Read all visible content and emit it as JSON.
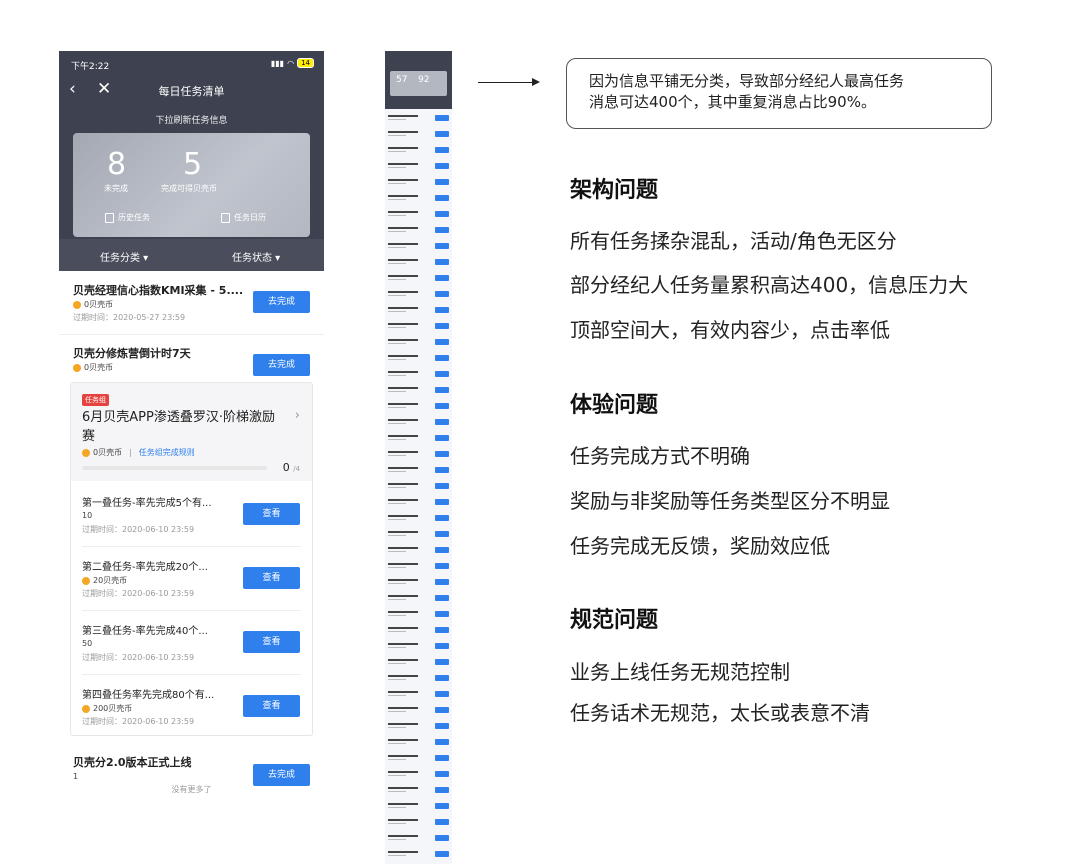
{
  "phone": {
    "status_time": "下午2:22",
    "battery": "14",
    "nav_title": "每日任务清单",
    "pull_refresh": "下拉刷新任务信息",
    "stats": {
      "unfinished_num": "8",
      "unfinished_label": "未完成",
      "coins_num": "5",
      "coins_label": "完成可得贝壳币"
    },
    "history_label": "历史任务",
    "calendar_label": "任务日历",
    "filter_category": "任务分类 ▾",
    "filter_status": "任务状态 ▾",
    "tasks": [
      {
        "title": "贝壳经理信心指数KMI采集 - 5....",
        "coin": "0贝壳币",
        "date": "过期时间：2020-05-27 23:59",
        "button": "去完成"
      },
      {
        "title": "贝壳分修炼营倒计时7天",
        "coin": "0贝壳币",
        "button": "去完成"
      }
    ],
    "group": {
      "tag": "任务组",
      "title": "6月贝壳APP渗透叠罗汉·阶梯激励赛",
      "coin": "0贝壳币",
      "sep": "|",
      "rule": "任务组完成规则",
      "progress_done": "0",
      "progress_total": "/4",
      "progress_fraction": 0,
      "subtasks": [
        {
          "title": "第一叠任务-率先完成5个有...",
          "coin": "10",
          "date": "过期时间：2020-06-10 23:59",
          "button": "查看",
          "has_coin": false
        },
        {
          "title": "第二叠任务-率先完成20个...",
          "coin": "20贝壳币",
          "date": "过期时间：2020-06-10 23:59",
          "button": "查看",
          "has_coin": true
        },
        {
          "title": "第三叠任务-率先完成40个...",
          "coin": "50",
          "date": "过期时间：2020-06-10 23:59",
          "button": "查看",
          "has_coin": false
        },
        {
          "title": "第四叠任务率先完成80个有...",
          "coin": "200贝壳币",
          "date": "过期时间：2020-06-10 23:59",
          "button": "查看",
          "has_coin": true
        }
      ]
    },
    "last_task": {
      "title": "贝壳分2.0版本正式上线",
      "coin": "1",
      "button": "去完成"
    },
    "no_more": "没有更多了"
  },
  "strip": {
    "stat_a": "57",
    "stat_b": "92"
  },
  "note": {
    "line1": "因为信息平铺无分类，导致部分经纪人最高任务",
    "line2": "消息可达400个，其中重复消息占比90%。"
  },
  "sections": [
    {
      "title": "架构问题",
      "items": [
        "所有任务揉杂混乱，活动/角色无区分",
        "部分经纪人任务量累积高达400，信息压力大",
        "顶部空间大，有效内容少，点击率低"
      ]
    },
    {
      "title": "体验问题",
      "items": [
        "任务完成方式不明确",
        "奖励与非奖励等任务类型区分不明显",
        "任务完成无反馈，奖励效应低"
      ]
    },
    {
      "title": "规范问题",
      "items": [
        "业务上线任务无规范控制",
        "任务话术无规范，太长或表意不清"
      ]
    }
  ],
  "colors": {
    "primary": "#2f80ed",
    "header": "#3e4250",
    "tag": "#e64340",
    "coin": "#f5a623"
  }
}
